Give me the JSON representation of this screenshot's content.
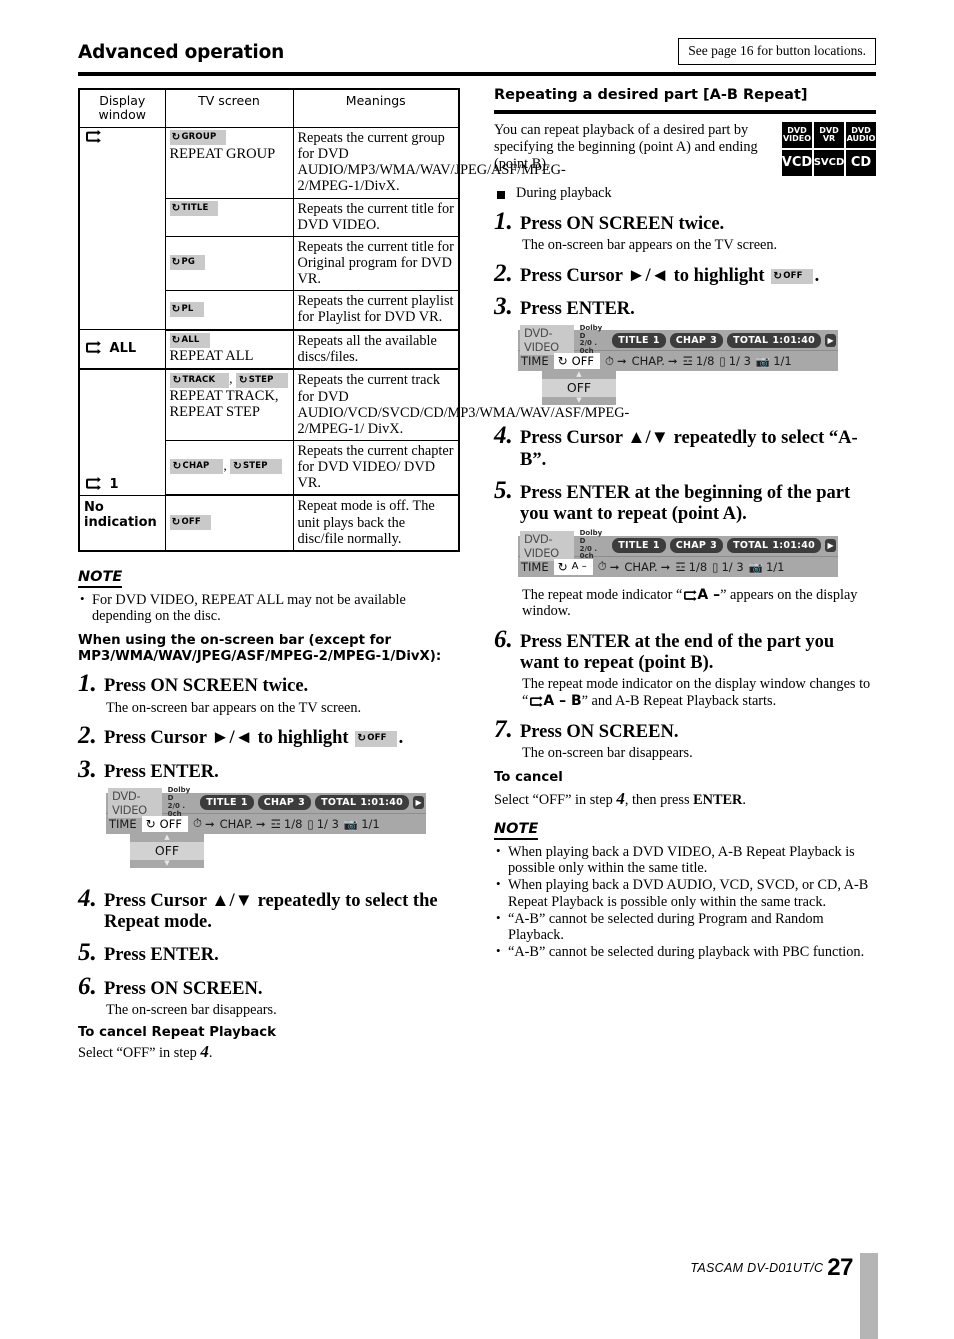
{
  "header": {
    "title": "Advanced operation",
    "note_box": "See page 16 for button locations."
  },
  "left": {
    "table": {
      "headers": [
        "Display\nwindow",
        "TV screen",
        "Meanings"
      ],
      "header_display": "Display window",
      "header_tv": "TV screen",
      "header_meanings": "Meanings",
      "rows": [
        {
          "display": "repeat-icon",
          "display_text": "",
          "chip": "GROUP",
          "label": "REPEAT GROUP",
          "meaning": "Repeats the current group for DVD AUDIO/MP3/WMA/WAV/JPEG/ASF/MPEG-2/MPEG-1/DivX."
        },
        {
          "display": "",
          "chip": "TITLE",
          "label": "",
          "meaning": "Repeats the current title for DVD VIDEO."
        },
        {
          "display": "",
          "chip": "PG",
          "label": "",
          "meaning": "Repeats the current title for Original program for DVD VR."
        },
        {
          "display": "",
          "chip": "PL",
          "label": "",
          "meaning": "Repeats the current playlist for Playlist for DVD VR."
        },
        {
          "display_text": "ALL",
          "chip": "ALL",
          "label": "REPEAT ALL",
          "meaning": "Repeats all the available discs/files."
        },
        {
          "display_text": "1",
          "chip": "TRACK",
          "chip2": "STEP",
          "label": "REPEAT TRACK, REPEAT STEP",
          "meaning": "Repeats the current track for DVD AUDIO/VCD/SVCD/CD/MP3/WMA/WAV/ASF/MPEG-2/MPEG-1/ DivX."
        },
        {
          "display_text": "",
          "chip": "CHAP",
          "chip2": "STEP",
          "label": "",
          "meaning": "Repeats the current chapter for DVD VIDEO/ DVD VR."
        },
        {
          "display_text": "No indication",
          "chip": "OFF",
          "label": "",
          "meaning": "Repeat mode is off. The unit plays back the disc/file normally."
        }
      ]
    },
    "note_label": "NOTE",
    "note_items": [
      "For DVD VIDEO, REPEAT ALL may not be available depending on the disc."
    ],
    "subhead": "When using the on-screen bar (except for MP3/WMA/WAV/JPEG/ASF/MPEG-2/MPEG-1/DivX):",
    "steps": [
      {
        "num": "1.",
        "text": "Press ON SCREEN twice.",
        "sub": "The on-screen bar appears on the TV screen."
      },
      {
        "num": "2.",
        "text": "Press Cursor ►/◄ to highlight",
        "chip": "OFF",
        "after": "."
      },
      {
        "num": "3.",
        "text": "Press ENTER.",
        "sub": ""
      },
      {
        "num": "4.",
        "text": "Press Cursor ▲/▼ repeatedly to select the Repeat mode.",
        "sub": ""
      },
      {
        "num": "5.",
        "text": "Press ENTER.",
        "sub": ""
      },
      {
        "num": "6.",
        "text": "Press ON SCREEN.",
        "sub": "The on-screen bar disappears."
      }
    ],
    "cancel_head": "To cancel Repeat Playback",
    "cancel_text_before": "Select “OFF” in step",
    "cancel_step_num": "4",
    "cancel_text_after": "."
  },
  "osd": {
    "disc_type": "DVD-VIDEO",
    "audio_line1": "Dolby D",
    "audio_line2": "2/0 . 0ch",
    "title_label": "TITLE",
    "title_value": "1",
    "chap_label": "CHAP",
    "chap_value": "3",
    "total_label": "TOTAL",
    "total_value": "1:01:40",
    "time_label": "TIME",
    "repeat_value_off": "OFF",
    "repeat_value_a": "A –",
    "time_icon": "clock-icon",
    "chap_nav_label": "CHAP.",
    "audio_value": "1/8",
    "subtitle_value": "1/ 3",
    "angle_value": "1/1",
    "dropdown_value": "OFF"
  },
  "right": {
    "section_title": "Repeating a desired part [A-B Repeat]",
    "intro": "You can repeat playback of a desired part by specifying the beginning (point A) and ending (point B).",
    "bullet": "During playback",
    "disc_badges": [
      {
        "lines": [
          "DVD",
          "VIDEO"
        ],
        "type": "two"
      },
      {
        "lines": [
          "DVD",
          "VR"
        ],
        "type": "two"
      },
      {
        "lines": [
          "DVD",
          "AUDIO"
        ],
        "type": "two"
      },
      {
        "lines": [
          "VCD"
        ],
        "type": "one"
      },
      {
        "lines": [
          "SVCD"
        ],
        "type": "one-small"
      },
      {
        "lines": [
          "CD"
        ],
        "type": "one"
      }
    ],
    "steps": [
      {
        "num": "1.",
        "text": "Press ON SCREEN twice.",
        "sub": "The on-screen bar appears on the TV screen."
      },
      {
        "num": "2.",
        "text": "Press Cursor ►/◄ to highlight",
        "chip": "OFF",
        "after": "."
      },
      {
        "num": "3.",
        "text": "Press ENTER.",
        "sub": ""
      },
      {
        "num": "4.",
        "text": "Press Cursor ▲/▼ repeatedly to select “A-B”.",
        "sub": ""
      },
      {
        "num": "5.",
        "text": "Press ENTER at the beginning of the part you want to repeat (point A).",
        "sub": ""
      },
      {
        "num": "6.",
        "text": "Press ENTER at the end of the part you want to repeat (point B).",
        "sub": ""
      },
      {
        "num": "7.",
        "text": "Press ON SCREEN.",
        "sub": "The on-screen bar disappears."
      }
    ],
    "after_step5_sub_a": "The repeat mode indicator “",
    "after_step5_ind": "A –",
    "after_step5_sub_b": "” appears on the display window.",
    "after_step6_sub_a": "The repeat mode indicator on the display window changes to",
    "after_step6_ind": "A – B",
    "after_step6_sub_b": "” and A-B Repeat Playback starts.",
    "after_step6_quote": "“",
    "cancel_head": "To cancel",
    "cancel_before": "Select “OFF” in step",
    "cancel_step_num": "4",
    "cancel_mid": ", then press",
    "cancel_bold": "ENTER",
    "cancel_after": ".",
    "note_label": "NOTE",
    "note_items": [
      "When playing back a DVD VIDEO, A-B Repeat Playback is possible only within the same title.",
      "When playing back a DVD AUDIO, VCD, SVCD, or CD, A-B Repeat Playback is possible only within the same track.",
      "“A-B” cannot be selected during Program and Random Playback.",
      "“A-B” cannot be selected during playback with PBC function."
    ]
  },
  "footer": {
    "brand": "TASCAM",
    "model": "DV-D01UT/C",
    "page": "27"
  }
}
